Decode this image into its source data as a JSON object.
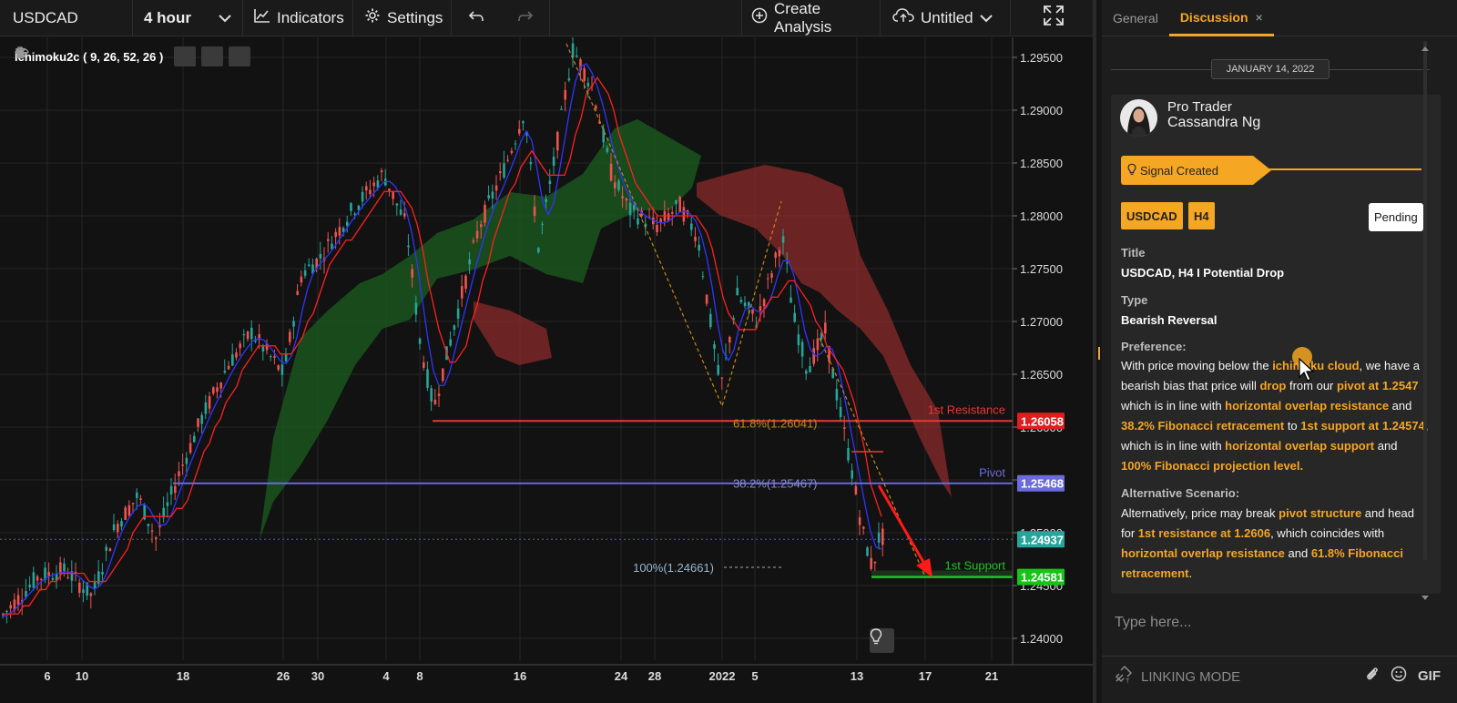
{
  "toolbar": {
    "symbol": "USDCAD",
    "interval": "4 hour",
    "indicators_label": "Indicators",
    "settings_label": "Settings",
    "create_analysis_label": "Create Analysis",
    "layout_name": "Untitled"
  },
  "chart": {
    "indicator_legend": "Ichimoku2c ( 9, 26, 52, 26 )",
    "price_axis": [
      "1.29500",
      "1.29000",
      "1.28500",
      "1.28000",
      "1.27500",
      "1.27000",
      "1.26500",
      "1.26000",
      "1.25500",
      "1.25000",
      "1.24500",
      "1.24000"
    ],
    "time_axis": [
      "6",
      "10",
      "18",
      "26",
      "30",
      "4",
      "8",
      "16",
      "24",
      "28",
      "2022",
      "5",
      "13",
      "17",
      "21"
    ],
    "levels": {
      "resistance": {
        "label": "1st Resistance",
        "price": "1.26058",
        "color": "#e53935"
      },
      "pivot": {
        "label": "Pivot",
        "price": "1.25468",
        "color": "#6b6bdc"
      },
      "support": {
        "label": "1st Support",
        "price": "1.24581",
        "color": "#22c32a"
      },
      "last_price": {
        "price": "1.24937",
        "color": "#26a69a"
      }
    },
    "fib_labels": {
      "fib_618": "61.8%(1.26041)",
      "fib_382": "38.2%(1.25467)",
      "fib_100": "100%(1.24661)"
    },
    "colors": {
      "bull": "#26a69a",
      "bear": "#ef5350",
      "tenkan": "#2f35ff",
      "kijun": "#ff2020",
      "cloud_bull": "#1b5e20",
      "cloud_bear": "#8b2a2a"
    }
  },
  "panel": {
    "tabs": {
      "general": "General",
      "discussion": "Discussion",
      "close": "×"
    },
    "date": "JANUARY 14, 2022",
    "author": {
      "role": "Pro Trader",
      "name": "Cassandra Ng"
    },
    "signal_label": "Signal Created",
    "badges": {
      "symbol": "USDCAD",
      "timeframe": "H4"
    },
    "status": "Pending",
    "title_label": "Title",
    "title_value": "USDCAD, H4 I Potential Drop",
    "type_label": "Type",
    "type_value": "Bearish Reversal",
    "preference_label": "Preference:",
    "preference": {
      "t1": "With price moving below the ",
      "h1": "ichimoku cloud",
      "t2": ", we have a bearish bias that price will ",
      "h2": "drop",
      "t3": " from our ",
      "h3": "pivot at 1.2547",
      "t4": " which is in line with ",
      "h4": "horizontal overlap resistance",
      "t5": " and ",
      "h5": "38.2% Fibonacci retracement",
      "t6": "  to ",
      "h6": "1st support at 1.24574",
      "t7": ", which is in line with ",
      "h7": "horizontal overlap support",
      "t8": " and ",
      "h8": "100% Fibonacci projection level."
    },
    "alternative_label": "Alternative Scenario:",
    "alternative": {
      "t1": "Alternatively, price may break ",
      "h1": "pivot structure",
      "t2": " and head for ",
      "h2": "1st resistance at 1.2606",
      "t3": ", which coincides with ",
      "h3": "horizontal overlap resistance",
      "t4": " and ",
      "h4": "61.8% Fibonacci retracement",
      "t5": "."
    },
    "input_placeholder": "Type here...",
    "linking_mode": "LINKING MODE",
    "gif_label": "GIF"
  }
}
